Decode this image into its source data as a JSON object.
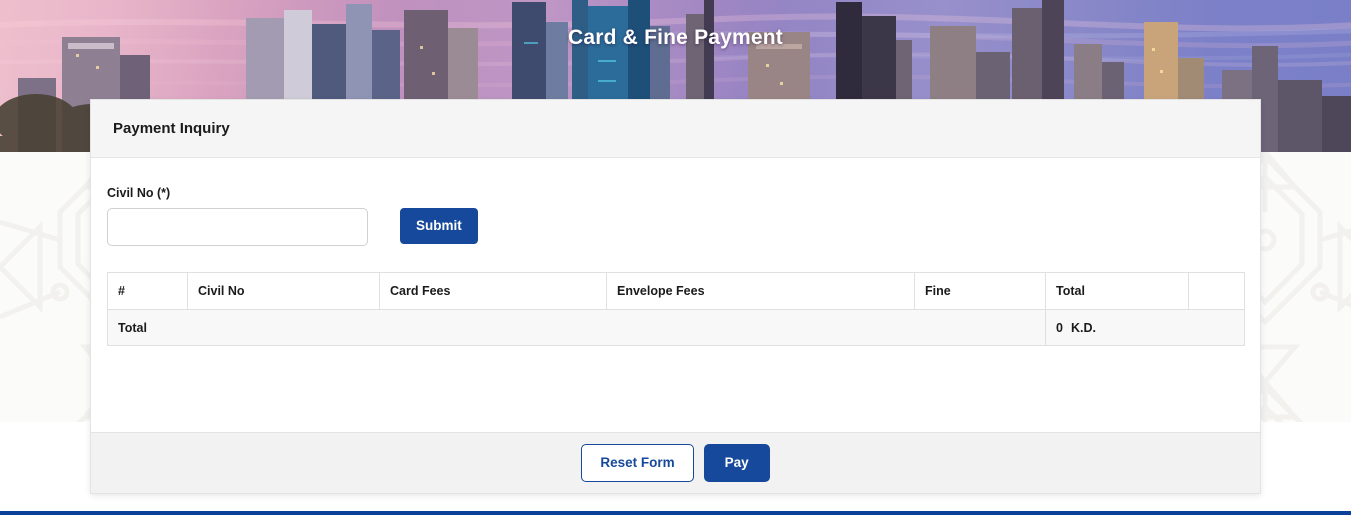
{
  "banner": {
    "title": "Card & Fine Payment",
    "image_alt": "kuwait-city-skyline-at-sunset"
  },
  "card": {
    "header_title": "Payment Inquiry"
  },
  "form": {
    "civil_no_label": "Civil No (*)",
    "civil_no_value": "",
    "civil_no_placeholder": "",
    "submit_label": "Submit"
  },
  "table": {
    "columns": [
      {
        "key": "index",
        "label": "#"
      },
      {
        "key": "civil_no",
        "label": "Civil No"
      },
      {
        "key": "card",
        "label": "Card Fees"
      },
      {
        "key": "envelope",
        "label": "Envelope Fees"
      },
      {
        "key": "fine",
        "label": "Fine"
      },
      {
        "key": "total",
        "label": "Total"
      },
      {
        "key": "action",
        "label": ""
      }
    ],
    "rows": [],
    "total_row": {
      "label": "Total",
      "amount": "0",
      "currency": "K.D."
    }
  },
  "footer": {
    "reset_label": "Reset Form",
    "pay_label": "Pay"
  },
  "colors": {
    "primary_blue": "#16499b",
    "bottom_bar_blue": "#0c4199",
    "panel_grey": "#f5f5f5",
    "footer_grey": "#f2f2f2",
    "table_row_grey": "#f8f8f8",
    "border_grey": "#e0e0e0"
  }
}
